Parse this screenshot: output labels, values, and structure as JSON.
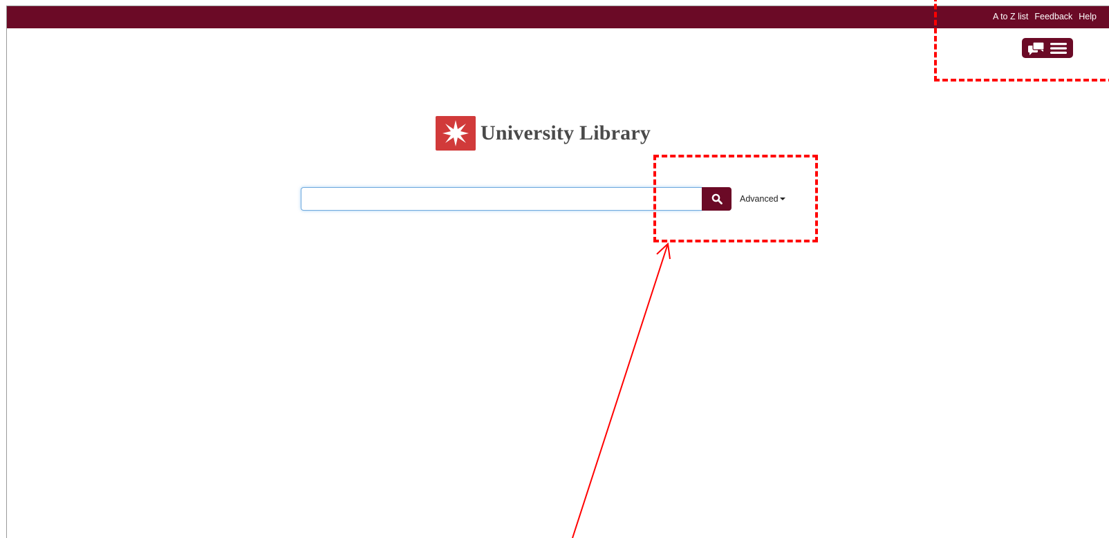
{
  "header": {
    "links": [
      "A to Z list",
      "Feedback",
      "Help"
    ],
    "bar_color": "#6b0a26"
  },
  "top_icons": {
    "chat_icon": "chat-icon",
    "menu_icon": "hamburger-menu-icon"
  },
  "logo": {
    "text": "University Library",
    "mark_color": "#d13a3a",
    "mark_icon": "star-burst-icon"
  },
  "search": {
    "value": "",
    "placeholder": "",
    "button_icon": "search-icon",
    "advanced_label": "Advanced"
  },
  "annotations": {
    "color": "#ff0000",
    "style": "dashed"
  }
}
